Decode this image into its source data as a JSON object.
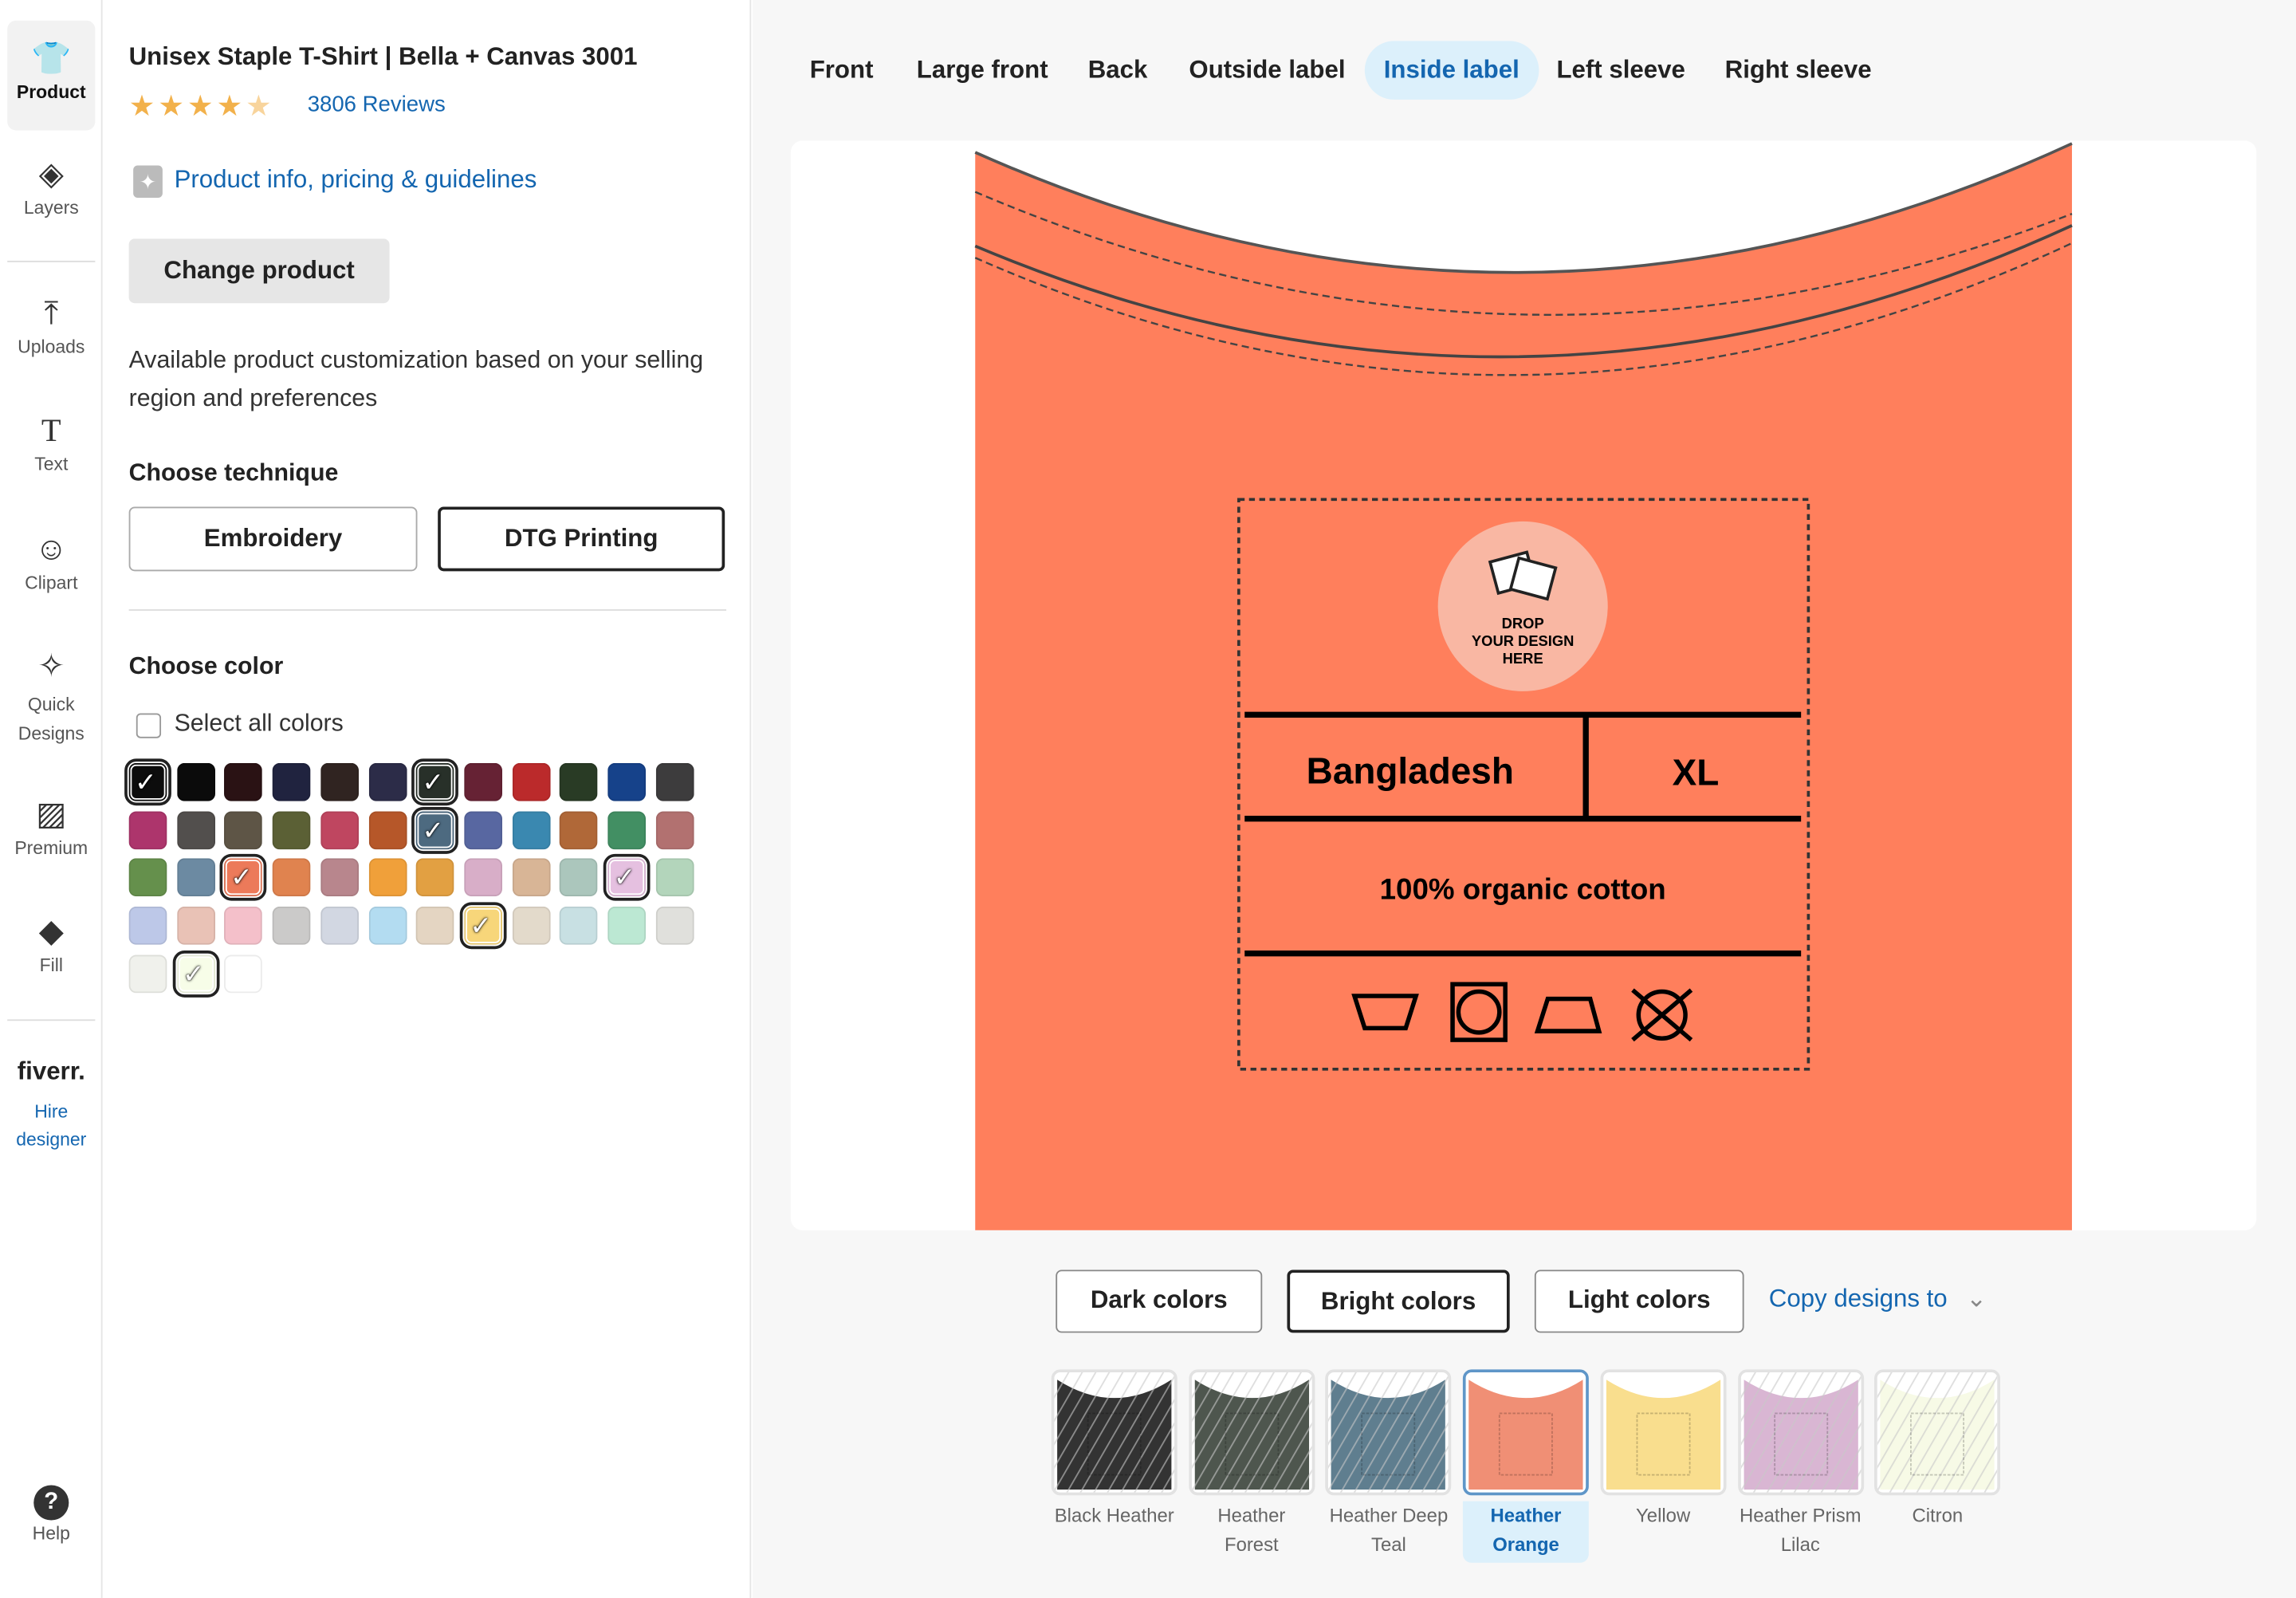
{
  "nav": {
    "items": [
      {
        "label": "Product",
        "icon": "shirt-icon",
        "glyph": "⇧"
      },
      {
        "label": "Layers",
        "icon": "layers-icon",
        "glyph": "◈"
      },
      {
        "label": "Uploads",
        "icon": "upload-icon",
        "glyph": "⤒"
      },
      {
        "label": "Text",
        "icon": "text-icon",
        "glyph": "T"
      },
      {
        "label": "Clipart",
        "icon": "smiley-icon",
        "glyph": "☺"
      },
      {
        "label": "Quick Designs",
        "icon": "sparkle-icon",
        "glyph": "✨"
      },
      {
        "label": "Premium",
        "icon": "premium-image-icon",
        "glyph": "▨"
      },
      {
        "label": "Fill",
        "icon": "paint-bucket-icon",
        "glyph": "◆"
      }
    ],
    "fiverr_logo": "fiverr.",
    "hire_label": "Hire designer",
    "help_label": "Help"
  },
  "product": {
    "title": "Unisex Staple T-Shirt | Bella + Canvas 3001",
    "rating": 4.5,
    "reviews": "3806 Reviews",
    "info_link": "Product info, pricing & guidelines",
    "change_label": "Change product",
    "note": "Available product customization based on your selling region and preferences",
    "technique_heading": "Choose technique",
    "techniques": [
      "Embroidery",
      "DTG Printing"
    ],
    "selected_technique": "DTG Printing",
    "color_heading": "Choose color",
    "select_all": "Select all colors",
    "swatches": [
      {
        "c": "#0c0c0c",
        "s": true
      },
      {
        "c": "#0b0b0b"
      },
      {
        "c": "#2a1214"
      },
      {
        "c": "#20233f"
      },
      {
        "c": "#302421"
      },
      {
        "c": "#2c2c48"
      },
      {
        "c": "#283029",
        "s": true
      },
      {
        "c": "#662234"
      },
      {
        "c": "#bb2a2b"
      },
      {
        "c": "#293b25"
      },
      {
        "c": "#16428a"
      },
      {
        "c": "#3d3c3d"
      },
      {
        "c": "#ad356c"
      },
      {
        "c": "#524f4d"
      },
      {
        "c": "#5e5546"
      },
      {
        "c": "#5b6035"
      },
      {
        "c": "#bf4660"
      },
      {
        "c": "#b65729"
      },
      {
        "c": "#4d6a80",
        "s": true
      },
      {
        "c": "#5867a1"
      },
      {
        "c": "#3a88b0"
      },
      {
        "c": "#b06838"
      },
      {
        "c": "#428f63"
      },
      {
        "c": "#b27170"
      },
      {
        "c": "#65904c"
      },
      {
        "c": "#6c8aa2"
      },
      {
        "c": "#ec7a5a",
        "s": true
      },
      {
        "c": "#e0834f"
      },
      {
        "c": "#b8868d"
      },
      {
        "c": "#f0a03a"
      },
      {
        "c": "#e2a042"
      },
      {
        "c": "#d8aec8"
      },
      {
        "c": "#d8b596"
      },
      {
        "c": "#abc6bc"
      },
      {
        "c": "#e5c0e0",
        "s": true
      },
      {
        "c": "#b3d5bb"
      },
      {
        "c": "#bdc8e8"
      },
      {
        "c": "#e9c2b6"
      },
      {
        "c": "#f4c0ca"
      },
      {
        "c": "#cbcac9"
      },
      {
        "c": "#d2d7e2"
      },
      {
        "c": "#b3dcf1"
      },
      {
        "c": "#e4d5c2"
      },
      {
        "c": "#f7d67a",
        "s": true
      },
      {
        "c": "#e3dacb"
      },
      {
        "c": "#c8e0e3"
      },
      {
        "c": "#bce8d3"
      },
      {
        "c": "#e0e0dc"
      },
      {
        "c": "#f0f1ec"
      },
      {
        "c": "#f7fde8",
        "s": true
      },
      {
        "c": "#ffffff"
      }
    ]
  },
  "tabs": [
    "Front",
    "Large front",
    "Back",
    "Outside label",
    "Inside label",
    "Left sleeve",
    "Right sleeve"
  ],
  "active_tab": "Inside label",
  "canvas": {
    "shirt_color": "#ff7f5c",
    "drop_text": [
      "DROP",
      "YOUR DESIGN",
      "HERE"
    ],
    "country": "Bangladesh",
    "size": "XL",
    "material": "100% organic cotton"
  },
  "filters": [
    "Dark colors",
    "Bright colors",
    "Light colors"
  ],
  "selected_filter": "Bright colors",
  "copy_label": "Copy designs to",
  "thumbs": [
    {
      "name": "Black Heather",
      "c": "#333333"
    },
    {
      "name": "Heather Forest",
      "c": "#4e564e"
    },
    {
      "name": "Heather Deep Teal",
      "c": "#5f7e8f"
    },
    {
      "name": "Heather Orange",
      "c": "#f08f75",
      "sel": true
    },
    {
      "name": "Yellow",
      "c": "#f9de8e"
    },
    {
      "name": "Heather Prism Lilac",
      "c": "#d9b6d3"
    },
    {
      "name": "Citron",
      "c": "#f7fae6"
    }
  ]
}
